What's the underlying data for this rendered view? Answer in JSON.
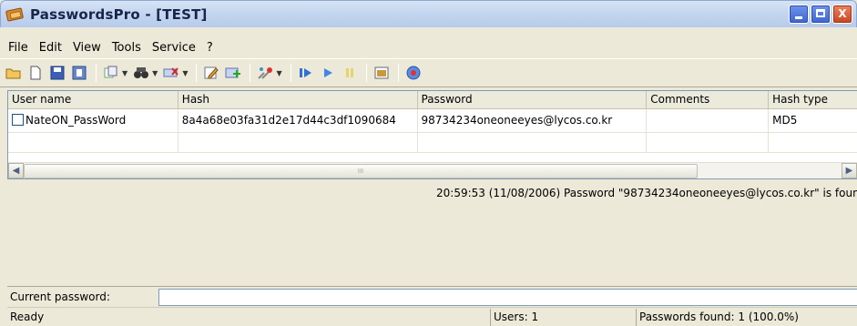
{
  "window": {
    "title": "PasswordsPro - [TEST]",
    "buttons": {
      "minimize": "_",
      "maximize": "□",
      "close": "X"
    }
  },
  "menu": [
    "File",
    "Edit",
    "View",
    "Tools",
    "Service",
    "?"
  ],
  "toolbar": {
    "icons": [
      "open-folder-icon",
      "new-icon",
      "save-icon",
      "save-as-icon",
      "copy-icon",
      "find-icon",
      "delete-icon",
      "edit-icon",
      "add-icon",
      "attack-icon",
      "start-icon",
      "continue-icon",
      "pause-icon",
      "settings-icon",
      "help-icon"
    ]
  },
  "grid": {
    "columns": [
      "User name",
      "Hash",
      "Password",
      "Comments",
      "Hash type"
    ],
    "rows": [
      {
        "user": "NateON_PassWord",
        "hash": "8a4a68e03fa31d2e17d44c3df1090684",
        "password": "98734234oneoneeyes@lycos.co.kr",
        "comments": "",
        "hash_type": "MD5"
      }
    ],
    "scroll_grip": "III"
  },
  "log": {
    "line": "20:59:53 (11/08/2006)  Password \"98734234oneoneeyes@lycos.co.kr\" is foun"
  },
  "current_password": {
    "label": "Current password:",
    "value": ""
  },
  "status": {
    "state": "Ready",
    "users": "Users: 1",
    "found": "Passwords found: 1 (100.0%)"
  }
}
